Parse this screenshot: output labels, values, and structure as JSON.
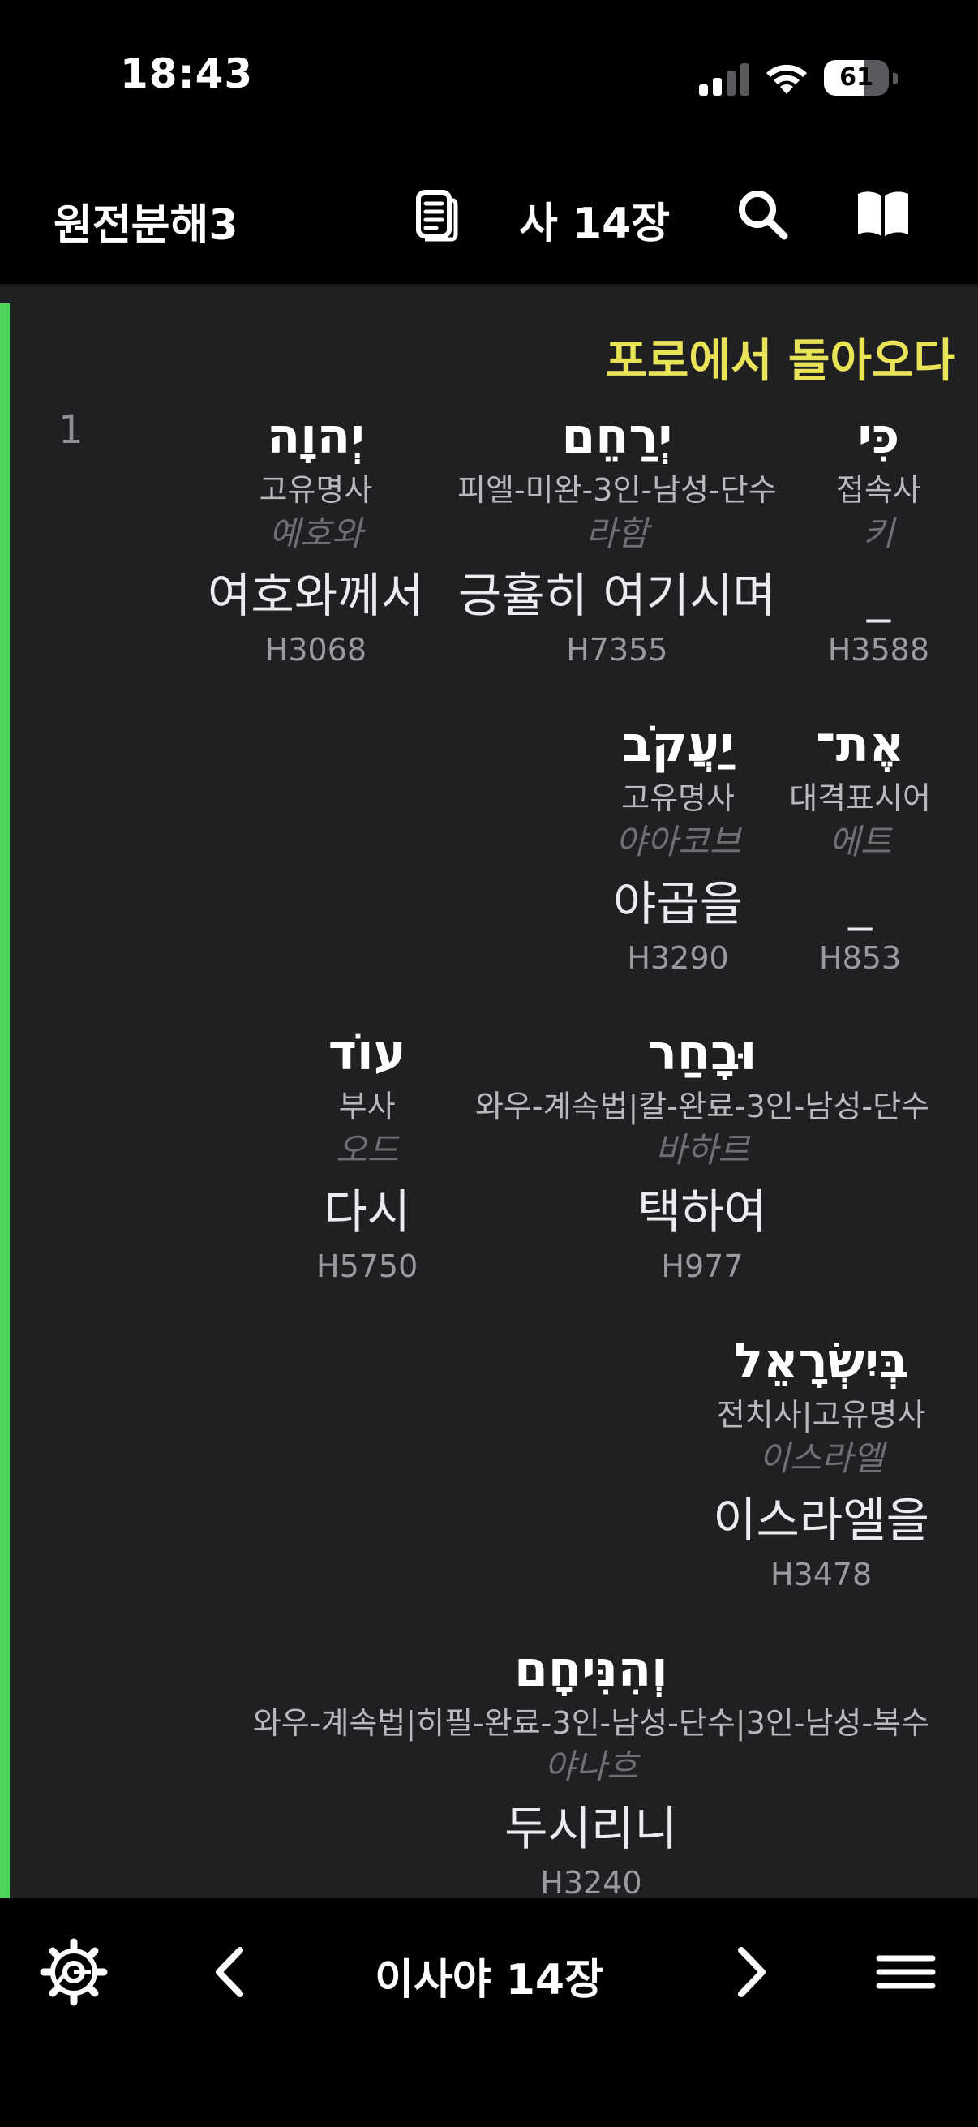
{
  "status_bar": {
    "time": "18:43",
    "battery_percent": "61",
    "battery_level": 0.61
  },
  "header": {
    "app_title": "원전분해3",
    "chapter": "사 14장"
  },
  "content": {
    "section_heading": "포로에서 돌아오다",
    "verse_number": "1",
    "words": [
      {
        "hebrew": "כִּי",
        "parse": "접속사",
        "translit": "키",
        "meaning": "_",
        "strong": "H3588"
      },
      {
        "hebrew": "יְרַחֵם",
        "parse": "피엘-미완-3인-남성-단수",
        "translit": "라함",
        "meaning": "긍휼히 여기시며",
        "strong": "H7355"
      },
      {
        "hebrew": "יְהוָה",
        "parse": "고유명사",
        "translit": "예호와",
        "meaning": "여호와께서",
        "strong": "H3068"
      },
      {
        "hebrew": "אֶת־",
        "parse": "대격표시어",
        "translit": "에트",
        "meaning": "_",
        "strong": "H853"
      },
      {
        "hebrew": "יַעֲקֹב",
        "parse": "고유명사",
        "translit": "야아코브",
        "meaning": "야곱을",
        "strong": "H3290"
      },
      {
        "hebrew": "וּבָחַר",
        "parse": "와우-계속법|칼-완료-3인-남성-단수",
        "translit": "바하르",
        "meaning": "택하여",
        "strong": "H977"
      },
      {
        "hebrew": "עוֹד",
        "parse": "부사",
        "translit": "오드",
        "meaning": "다시",
        "strong": "H5750"
      },
      {
        "hebrew": "בְּיִשְׂרָאֵל",
        "parse": "전치사|고유명사",
        "translit": "이스라엘",
        "meaning": "이스라엘을",
        "strong": "H3478"
      },
      {
        "hebrew": "וְהִנִּיחָם",
        "parse": "와우-계속법|히필-완료-3인-남성-단수|3인-남성-복수",
        "translit": "야나흐",
        "meaning": "두시리니",
        "strong": "H3240"
      }
    ]
  },
  "bottom_bar": {
    "chapter_title": "이사야 14장"
  },
  "icons": {
    "header": [
      "document-icon",
      "search-icon",
      "book-icon"
    ],
    "bottom": [
      "settings-icon",
      "chevron-left-icon",
      "chevron-right-icon",
      "menu-icon"
    ]
  },
  "colors": {
    "heading": "#e8e357",
    "accent_bar": "#4cd35a",
    "content_background": "#202022"
  }
}
